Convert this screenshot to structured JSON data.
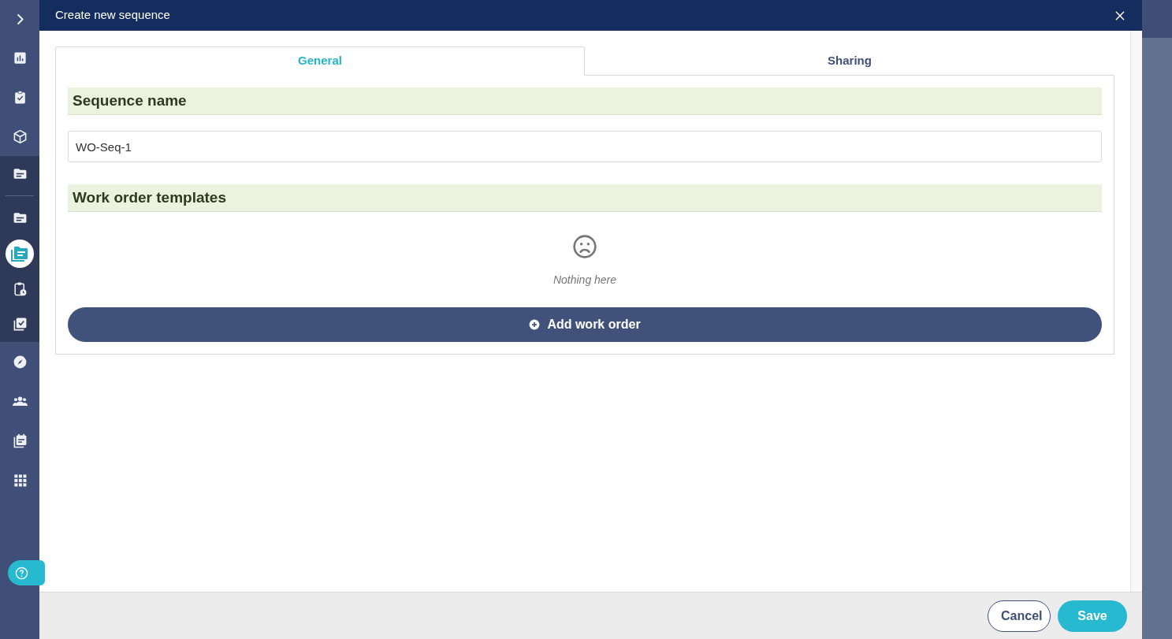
{
  "sidebar": {
    "sections": [
      {
        "emphasized": false,
        "items": [
          {
            "selected": false
          },
          {
            "selected": false
          },
          {
            "selected": false
          },
          {
            "selected": false
          }
        ]
      },
      {
        "emphasized": true,
        "items": [
          {
            "selected": false
          }
        ]
      },
      {
        "emphasized": true,
        "items": [
          {
            "selected": false
          },
          {
            "selected": true
          },
          {
            "selected": false
          },
          {
            "selected": false
          }
        ]
      },
      {
        "emphasized": false,
        "items": [
          {
            "selected": false
          },
          {
            "selected": false
          },
          {
            "selected": false
          },
          {
            "selected": false
          }
        ]
      }
    ]
  },
  "dialog": {
    "title": "Create new sequence",
    "tabs": [
      {
        "label": "General",
        "selected": true
      },
      {
        "label": "Sharing",
        "selected": false
      }
    ],
    "sections": [
      {
        "kind": "field",
        "heading": "Sequence name",
        "value": "WO-Seq-1"
      },
      {
        "kind": "list",
        "heading": "Work order templates",
        "empty_text": "Nothing here",
        "button": "Add work order"
      }
    ],
    "buttons": [
      {
        "label": "Cancel",
        "kind": "secondary"
      },
      {
        "label": "Save",
        "kind": "primary"
      }
    ]
  }
}
